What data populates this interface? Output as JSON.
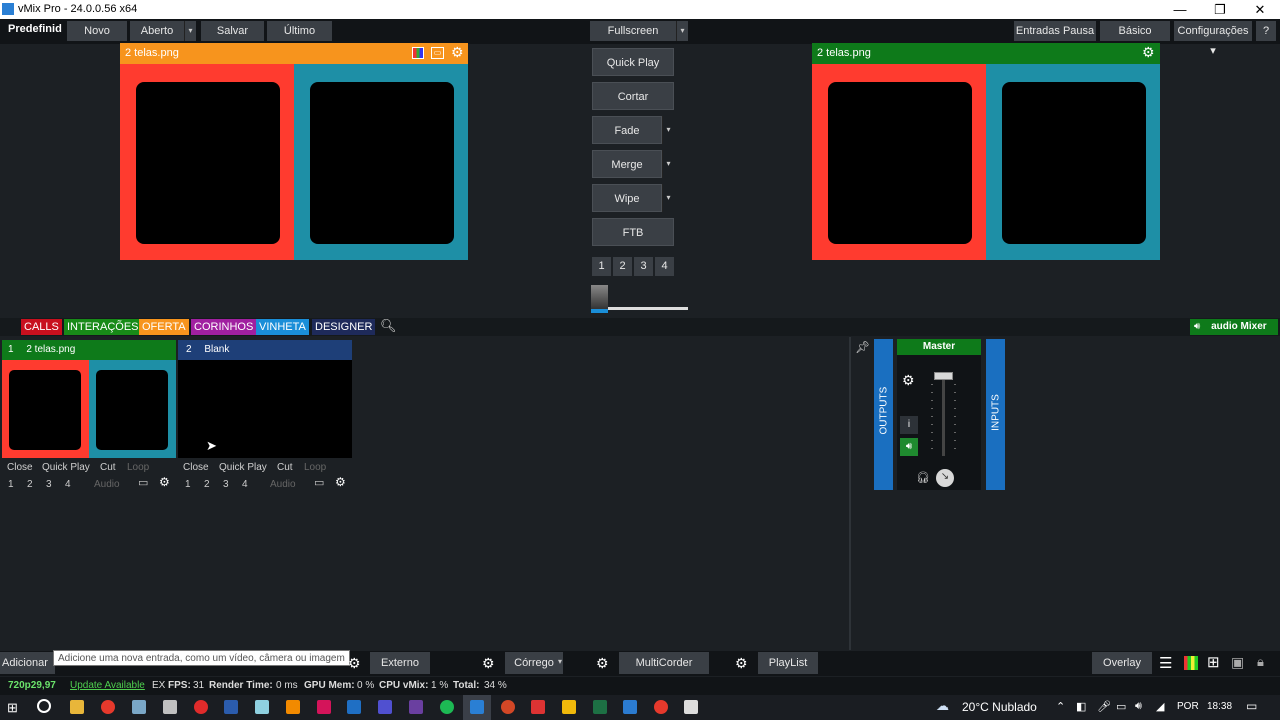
{
  "window": {
    "title": "vMix Pro - 24.0.0.56 x64",
    "minimize": "—",
    "restore": "❐",
    "close": "✕"
  },
  "toolbar": {
    "preset": "Predefinid",
    "novo": "Novo",
    "aberto": "Aberto",
    "salvar": "Salvar",
    "ultimo": "Último",
    "fullscreen": "Fullscreen",
    "entradas_pausa": "Entradas Pausa",
    "basico": "Básico",
    "configuracoes": "Configurações",
    "help": "?"
  },
  "preview": {
    "title": "2 telas.png",
    "color_left": "#ff3b2f",
    "color_right": "#1e8fa6",
    "header_color": "#f7941d"
  },
  "output": {
    "title": "2 telas.png",
    "header_color": "#0e7a1a"
  },
  "transitions": {
    "quick_play": "Quick Play",
    "cortar": "Cortar",
    "fade": "Fade",
    "merge": "Merge",
    "wipe": "Wipe",
    "ftb": "FTB",
    "numbers": [
      "1",
      "2",
      "3",
      "4"
    ],
    "tbar_position": 0
  },
  "tabs": [
    {
      "label": "CALLS",
      "color": "#c8101e"
    },
    {
      "label": "INTERAÇÕES",
      "color": "#188a18"
    },
    {
      "label": "OFERTA",
      "color": "#f7941d"
    },
    {
      "label": "CORINHOS",
      "color": "#a020a0"
    },
    {
      "label": "VINHETA",
      "color": "#1a8ed8"
    },
    {
      "label": "DESIGNER",
      "color": "#1e2a5a"
    }
  ],
  "audio_mixer_label": "audio Mixer",
  "inputs": [
    {
      "number": "1",
      "name": "2 telas.png",
      "header_color": "#0e7a1a",
      "close": "Close",
      "quick_play": "Quick Play",
      "cut": "Cut",
      "loop": "Loop",
      "audio": "Audio",
      "numbers": [
        "1",
        "2",
        "3",
        "4"
      ]
    },
    {
      "number": "2",
      "name": "Blank",
      "header_color": "#1e3f78",
      "close": "Close",
      "quick_play": "Quick Play",
      "cut": "Cut",
      "loop": "Loop",
      "audio": "Audio",
      "numbers": [
        "1",
        "2",
        "3",
        "4"
      ]
    }
  ],
  "mixer": {
    "master": "Master",
    "outputs": "OUTPUTS",
    "inputs": "INPUTS",
    "info": "i"
  },
  "bottom": {
    "adicionar": "Adicionar E",
    "tooltip": "Adicione uma nova entrada, como um vídeo, câmera ou imagem",
    "externo": "Externo",
    "corrego": "Córrego",
    "multicorder": "MultiCorder",
    "playlist": "PlayList",
    "overlay": "Overlay"
  },
  "status": {
    "resolution": "720p29,97",
    "update": "Update Available",
    "ex": "EX",
    "fps_label": "FPS:",
    "fps": "31",
    "render_label": "Render Time:",
    "render": "0 ms",
    "gpu_label": "GPU Mem:",
    "gpu": "0 %",
    "cpu_label": "CPU vMix:",
    "cpu": "1 %",
    "total_label": "Total:",
    "total": "34 %"
  },
  "taskbar": {
    "weather": "20°C  Nublado",
    "lang": "POR",
    "time": "18:38"
  }
}
